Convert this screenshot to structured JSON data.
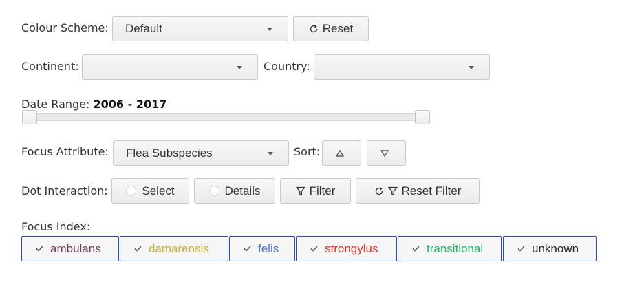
{
  "colour_scheme": {
    "label": "Colour Scheme:",
    "value": "Default",
    "reset_label": "Reset"
  },
  "location": {
    "continent_label": "Continent:",
    "continent_value": "",
    "country_label": "Country:",
    "country_value": ""
  },
  "date_range": {
    "label": "Date Range:",
    "value": "2006 - 2017"
  },
  "focus_attribute": {
    "label": "Focus Attribute:",
    "value": "Flea Subspecies",
    "sort_label": "Sort:"
  },
  "dot_interaction": {
    "label": "Dot Interaction:",
    "select_label": "Select",
    "details_label": "Details",
    "filter_label": "Filter",
    "reset_filter_label": "Reset Filter"
  },
  "focus_index": {
    "label": "Focus Index:",
    "items": [
      {
        "label": "ambulans",
        "color": "#6b3b5a"
      },
      {
        "label": "damarensis",
        "color": "#c9b23a"
      },
      {
        "label": "felis",
        "color": "#4f74c9"
      },
      {
        "label": "strongylus",
        "color": "#d23a2f"
      },
      {
        "label": "transitional",
        "color": "#27b36a"
      },
      {
        "label": "unknown",
        "color": "#222222"
      }
    ]
  }
}
